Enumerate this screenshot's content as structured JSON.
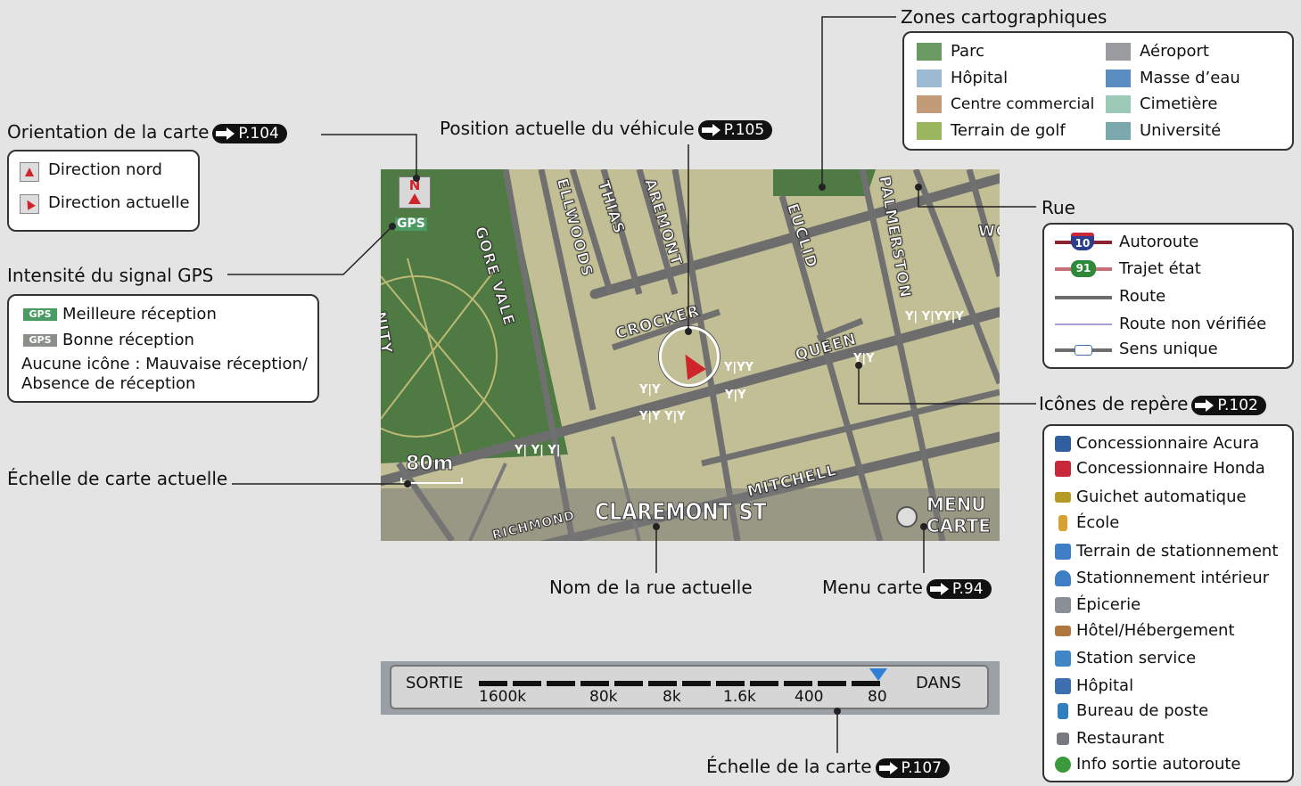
{
  "labels": {
    "zones_title": "Zones cartographiques",
    "orientation_title": "Orientation de la carte",
    "orientation_page": "P.104",
    "vehicle_title": "Position actuelle du véhicule",
    "vehicle_page": "P.105",
    "gps_title": "Intensité du signal GPS",
    "scale_title": "Échelle de carte actuelle",
    "street_name_title": "Nom de la rue actuelle",
    "map_menu_title": "Menu carte",
    "map_menu_page": "P.94",
    "rue_title": "Rue",
    "landmark_title": "Icônes de repère",
    "landmark_page": "P.102",
    "map_scale_title": "Échelle de la carte",
    "map_scale_page": "P.107"
  },
  "zones": [
    {
      "label": "Parc",
      "color": "#6a9a62"
    },
    {
      "label": "Aéroport",
      "color": "#9a9c9f"
    },
    {
      "label": "Hôpital",
      "color": "#9cbbd3"
    },
    {
      "label": "Masse d’eau",
      "color": "#5a8ec0"
    },
    {
      "label": "Centre commercial",
      "color": "#c29c78"
    },
    {
      "label": "Cimetière",
      "color": "#9dcab6"
    },
    {
      "label": "Terrain de golf",
      "color": "#9cb660"
    },
    {
      "label": "Université",
      "color": "#7aa8ad"
    }
  ],
  "orientation_items": [
    {
      "label": "Direction nord",
      "icon": "north-up-icon"
    },
    {
      "label": "Direction actuelle",
      "icon": "heading-up-icon"
    }
  ],
  "gps_items": {
    "best": "Meilleure réception",
    "good": "Bonne réception",
    "none_line1": "Aucune icône : Mauvaise réception/",
    "none_line2": "Absence de réception",
    "icon_text": "GPS"
  },
  "rue_items": [
    {
      "label": "Autoroute",
      "badge": "10"
    },
    {
      "label": "Trajet état",
      "badge": "91"
    },
    {
      "label": "Route"
    },
    {
      "label": "Route non vérifiée"
    },
    {
      "label": "Sens unique"
    }
  ],
  "landmarks": [
    {
      "label": "Concessionnaire Acura",
      "icon": "acura-icon",
      "color": "#2f5f9e",
      "glyph": "A"
    },
    {
      "label": "Concessionnaire Honda",
      "icon": "honda-icon",
      "color": "#c8283a",
      "glyph": "H"
    },
    {
      "label": "Guichet automatique",
      "icon": "atm-icon",
      "color": "#b59a25",
      "glyph": "ATM"
    },
    {
      "label": "École",
      "icon": "school-icon",
      "color": "#d6a232",
      "glyph": ""
    },
    {
      "label": "Terrain de stationnement",
      "icon": "parking-icon",
      "color": "#3d7ec4",
      "glyph": "P"
    },
    {
      "label": "Stationnement intérieur",
      "icon": "indoor-parking-icon",
      "color": "#3d7ec4",
      "glyph": "P"
    },
    {
      "label": "Épicerie",
      "icon": "grocery-icon",
      "color": "#8a8f95",
      "glyph": ""
    },
    {
      "label": "Hôtel/Hébergement",
      "icon": "hotel-icon",
      "color": "#b07840",
      "glyph": ""
    },
    {
      "label": "Station service",
      "icon": "gas-station-icon",
      "color": "#3f86c6",
      "glyph": ""
    },
    {
      "label": "Hôpital",
      "icon": "hospital-icon",
      "color": "#3d6fb0",
      "glyph": "H"
    },
    {
      "label": "Bureau de poste",
      "icon": "post-office-icon",
      "color": "#2f7fbf",
      "glyph": ""
    },
    {
      "label": "Restaurant",
      "icon": "restaurant-icon",
      "color": "#777b80",
      "glyph": "Y"
    },
    {
      "label": "Info sortie autoroute",
      "icon": "exit-info-icon",
      "color": "#3b9a3b",
      "glyph": "i"
    }
  ],
  "map": {
    "compass_letter": "N",
    "gps_text": "GPS",
    "scale_text": "80m",
    "current_street": "CLAREMONT ST",
    "menu_line1": "MENU",
    "menu_line2": "CARTE",
    "streets": [
      "GORE VALE",
      "ELLWOODS",
      "THIAS",
      "AREMONT",
      "EUCLID",
      "PALMERSTON",
      "CROCKER",
      "QUEEN",
      "MITCHELL",
      "RICHMOND",
      "NITY",
      "WO"
    ]
  },
  "scale_bar": {
    "left": "SORTIE",
    "right": "DANS",
    "ticks": [
      "1600k",
      "80k",
      "8k",
      "1.6k",
      "400",
      "80"
    ]
  }
}
